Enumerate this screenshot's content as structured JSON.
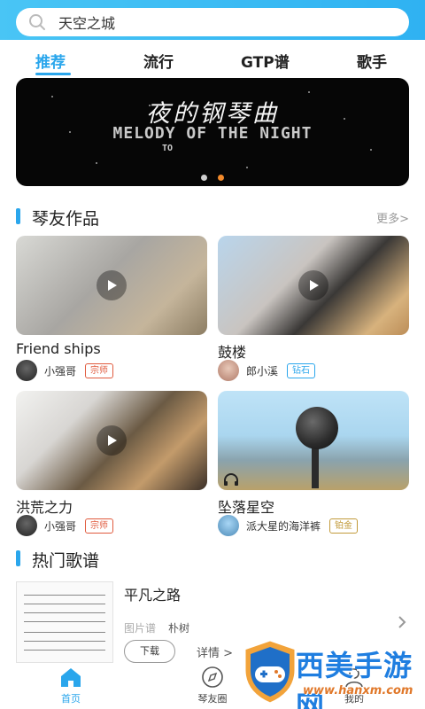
{
  "search": {
    "text": "天空之城"
  },
  "tabs": [
    {
      "label": "推荐",
      "active": true
    },
    {
      "label": "流行",
      "active": false
    },
    {
      "label": "GTP谱",
      "active": false
    },
    {
      "label": "歌手",
      "active": false
    }
  ],
  "banner": {
    "title_cn": "夜的钢琴曲",
    "title_en": "MELODY OF THE NIGHT",
    "sub": "TO",
    "page_count": 2,
    "active_index": 1
  },
  "works": {
    "title": "琴友作品",
    "more": "更多>",
    "cards": [
      {
        "title": "Friend ships",
        "author": "小强哥",
        "badge": "宗师",
        "badge_color": "#e05a3d"
      },
      {
        "title": "鼓楼",
        "author": "郎小溪",
        "badge": "钻石",
        "badge_color": "#2aa6ec"
      },
      {
        "title": "洪荒之力",
        "author": "小强哥",
        "badge": "宗师",
        "badge_color": "#e05a3d"
      },
      {
        "title": "坠落星空",
        "author": "派大星的海洋裤",
        "badge": "铂金",
        "badge_color": "#c29a3a"
      }
    ]
  },
  "hot": {
    "title": "热门歌谱",
    "item": {
      "title": "平凡之路",
      "type": "图片谱",
      "author": "朴树",
      "download": "下载",
      "detail": "详情 >"
    }
  },
  "nav": {
    "items": [
      {
        "label": "首页",
        "icon": "home-icon",
        "active": true
      },
      {
        "label": "琴友圈",
        "icon": "compass-icon",
        "active": false
      },
      {
        "label": "我的",
        "icon": "user-icon",
        "active": false
      }
    ]
  },
  "watermark": {
    "title": "西美手游网",
    "url": "www.hanxm.com"
  },
  "colors": {
    "accent": "#2aa6ec",
    "header": "#3bb8f4",
    "banner_dot_active": "#f28a2b"
  }
}
